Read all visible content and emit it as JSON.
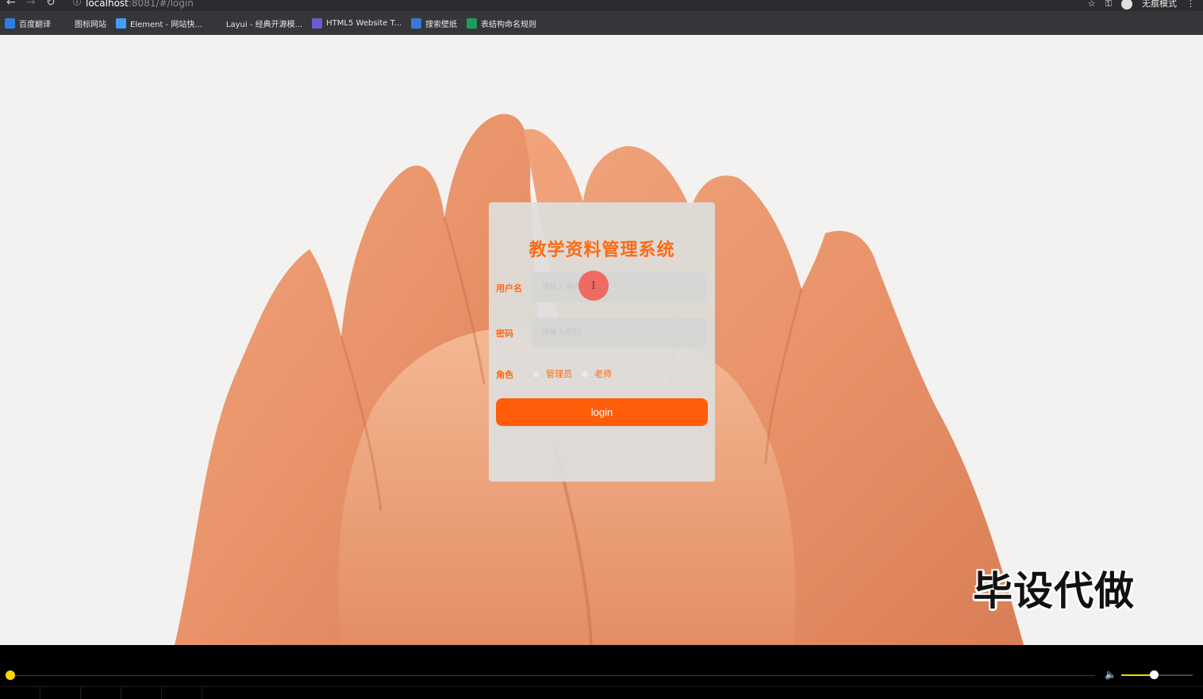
{
  "browser": {
    "url_host": "localhost",
    "url_rest": ":8081/#/login",
    "incognito_label": "无痕模式",
    "bookmarks": [
      {
        "label": "百度翻译",
        "icon": "baidu-translate-icon",
        "color": "#2f7de1"
      },
      {
        "label": "图标网站",
        "icon": "flag-icon",
        "color": "#35363a"
      },
      {
        "label": "Element - 网站快...",
        "icon": "element-icon",
        "color": "#409eff"
      },
      {
        "label": "Layui - 经典开源模...",
        "icon": "layui-icon",
        "color": "#35363a"
      },
      {
        "label": "HTML5 Website T...",
        "icon": "html5-icon",
        "color": "#6b5bd2"
      },
      {
        "label": "搜索壁纸",
        "icon": "wallpaper-icon",
        "color": "#3a78d4"
      },
      {
        "label": "表结构命名规则",
        "icon": "sheet-icon",
        "color": "#1f9d55"
      }
    ]
  },
  "login": {
    "title": "教学资料管理系统",
    "username_label": "用户名",
    "username_placeholder": "请输入用户名",
    "password_label": "密码",
    "password_placeholder": "请输入密码",
    "role_label": "角色",
    "roles": [
      "管理员",
      "老师"
    ],
    "login_button": "login",
    "accent_color": "#ff6a12"
  },
  "watermark": "毕设代做",
  "player": {
    "progress": 0.0,
    "volume": 0.45
  }
}
